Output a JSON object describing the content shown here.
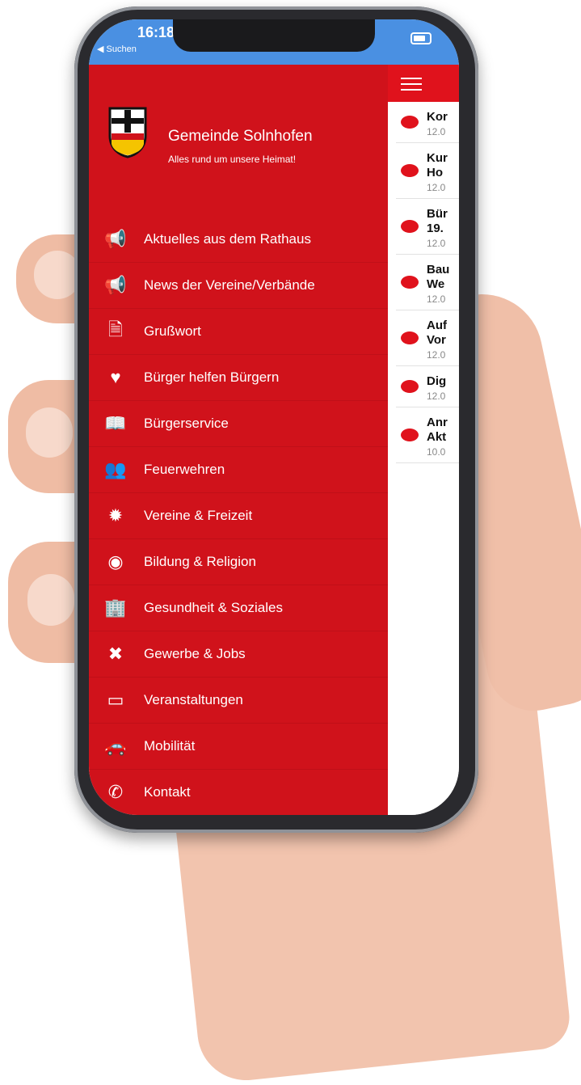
{
  "status_bar": {
    "time": "16:18",
    "back_label": "◀ Suchen"
  },
  "header": {
    "title": "Gemeinde Solnhofen",
    "subtitle": "Alles rund um unsere Heimat!"
  },
  "menu": [
    {
      "label": "Aktuelles aus dem Rathaus",
      "icon": "megaphone-icon"
    },
    {
      "label": "News der Vereine/Verbände",
      "icon": "megaphone-icon"
    },
    {
      "label": "Grußwort",
      "icon": "document-icon"
    },
    {
      "label": "Bürger helfen Bürgern",
      "icon": "heart-icon"
    },
    {
      "label": "Bürgerservice",
      "icon": "book-icon"
    },
    {
      "label": "Feuerwehren",
      "icon": "group-icon"
    },
    {
      "label": "Vereine & Freizeit",
      "icon": "sun-icon"
    },
    {
      "label": "Bildung & Religion",
      "icon": "people-circle-icon"
    },
    {
      "label": "Gesundheit & Soziales",
      "icon": "building-icon"
    },
    {
      "label": "Gewerbe & Jobs",
      "icon": "tools-icon"
    },
    {
      "label": "Veranstaltungen",
      "icon": "calendar-icon"
    },
    {
      "label": "Mobilität",
      "icon": "car-icon"
    },
    {
      "label": "Kontakt",
      "icon": "phone-icon"
    }
  ],
  "news": [
    {
      "title": "Kor",
      "title2": "",
      "date": "12.0"
    },
    {
      "title": "Kur",
      "title2": "Ho",
      "date": "12.0"
    },
    {
      "title": "Bür",
      "title2": "19.",
      "date": "12.0"
    },
    {
      "title": "Bau",
      "title2": "We",
      "date": "12.0"
    },
    {
      "title": "Auf",
      "title2": "Vor",
      "date": "12.0"
    },
    {
      "title": "Dig",
      "title2": "",
      "date": "12.0"
    },
    {
      "title": "Anr",
      "title2": "Akt",
      "date": "10.0"
    }
  ],
  "colors": {
    "brand_red": "#d0121b",
    "status_blue": "#4a90e2"
  }
}
